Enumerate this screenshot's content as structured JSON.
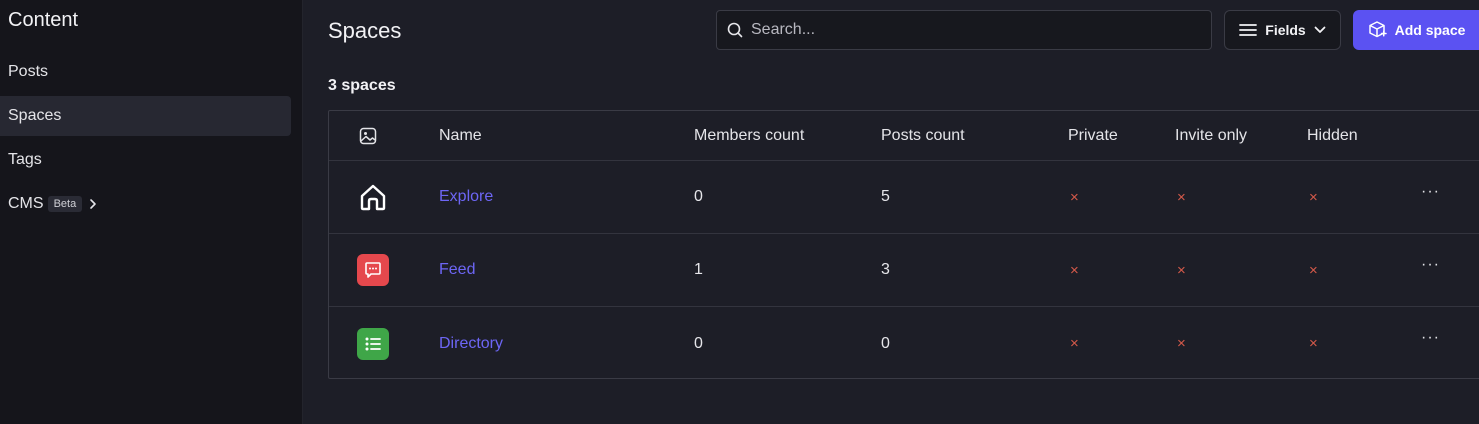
{
  "sidebar": {
    "title": "Content",
    "items": [
      {
        "label": "Posts"
      },
      {
        "label": "Spaces"
      },
      {
        "label": "Tags"
      },
      {
        "label": "CMS",
        "badge": "Beta"
      }
    ]
  },
  "header": {
    "title": "Spaces",
    "search_placeholder": "Search...",
    "fields_label": "Fields",
    "add_label": "Add space"
  },
  "count_label": "3 spaces",
  "table": {
    "columns": [
      "Name",
      "Members count",
      "Posts count",
      "Private",
      "Invite only",
      "Hidden"
    ],
    "rows": [
      {
        "icon": "home-icon",
        "name": "Explore",
        "members": "0",
        "posts": "5",
        "private": "×",
        "invite_only": "×",
        "hidden": "×",
        "more": "···"
      },
      {
        "icon": "chat-icon",
        "name": "Feed",
        "members": "1",
        "posts": "3",
        "private": "×",
        "invite_only": "×",
        "hidden": "×",
        "more": "···"
      },
      {
        "icon": "list-icon",
        "name": "Directory",
        "members": "0",
        "posts": "0",
        "private": "×",
        "invite_only": "×",
        "hidden": "×",
        "more": "···"
      }
    ]
  },
  "colors": {
    "accent": "#5b52f2",
    "link": "#6d66f5",
    "feed_icon_bg": "#e5484d",
    "directory_icon_bg": "#3fa648",
    "false_mark": "#d65a4a"
  }
}
